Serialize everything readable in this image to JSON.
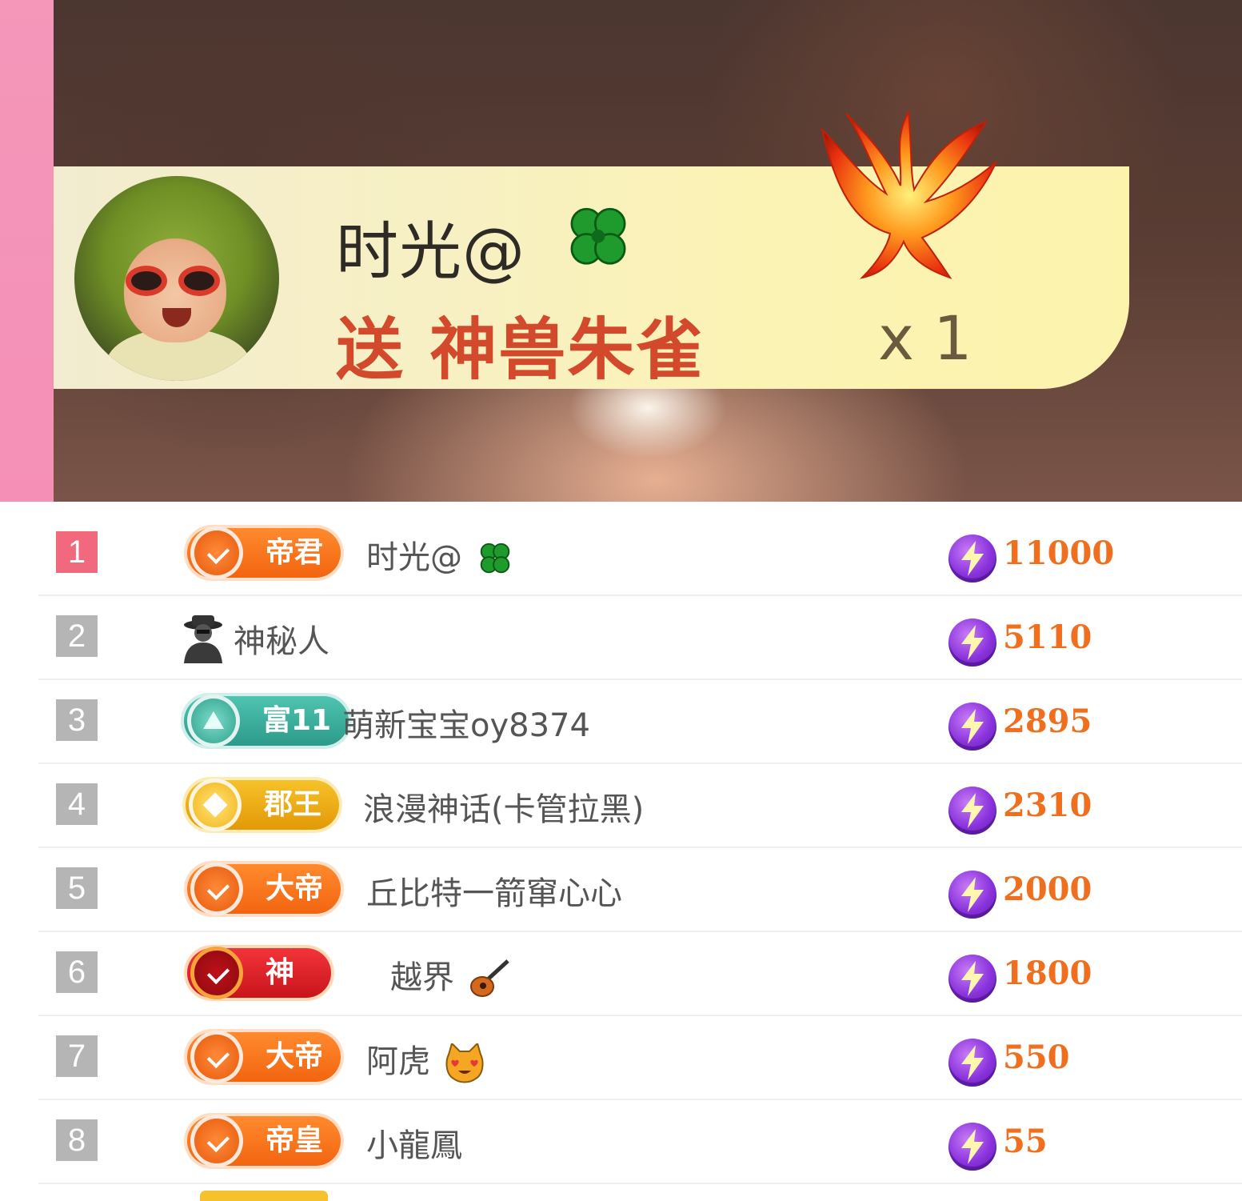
{
  "gift_banner": {
    "sender_name": "时光@",
    "gift_text": "送 神兽朱雀",
    "gift_count": "x 1",
    "gift_icon": "phoenix-icon",
    "sender_emoji": "four-leaf-clover-icon"
  },
  "ranking": [
    {
      "rank": "1",
      "badge": "帝君",
      "badge_style": "orange",
      "name": "时光@",
      "emoji": "four-leaf-clover-icon",
      "score": "11000"
    },
    {
      "rank": "2",
      "badge": "",
      "badge_style": "none",
      "name": "神秘人",
      "emoji": "",
      "score": "5110"
    },
    {
      "rank": "3",
      "badge": "富11",
      "badge_style": "teal",
      "name": "萌新宝宝oy8374",
      "emoji": "",
      "score": "2895"
    },
    {
      "rank": "4",
      "badge": "郡王",
      "badge_style": "gold",
      "name": "浪漫神话(卡管拉黑)",
      "emoji": "",
      "score": "2310"
    },
    {
      "rank": "5",
      "badge": "大帝",
      "badge_style": "orange",
      "name": "丘比特一箭窜心心",
      "emoji": "",
      "score": "2000"
    },
    {
      "rank": "6",
      "badge": "神",
      "badge_style": "red",
      "name": "越界",
      "emoji": "guitar-icon",
      "score": "1800"
    },
    {
      "rank": "7",
      "badge": "大帝",
      "badge_style": "orange",
      "name": "阿虎",
      "emoji": "heart-eyes-cat-icon",
      "score": "550"
    },
    {
      "rank": "8",
      "badge": "帝皇",
      "badge_style": "orange",
      "name": "小龍鳳",
      "emoji": "",
      "score": "55"
    }
  ],
  "colors": {
    "accent_pink": "#f497b9",
    "score_orange": "#ef6f1f",
    "gift_red": "#d2492b"
  }
}
